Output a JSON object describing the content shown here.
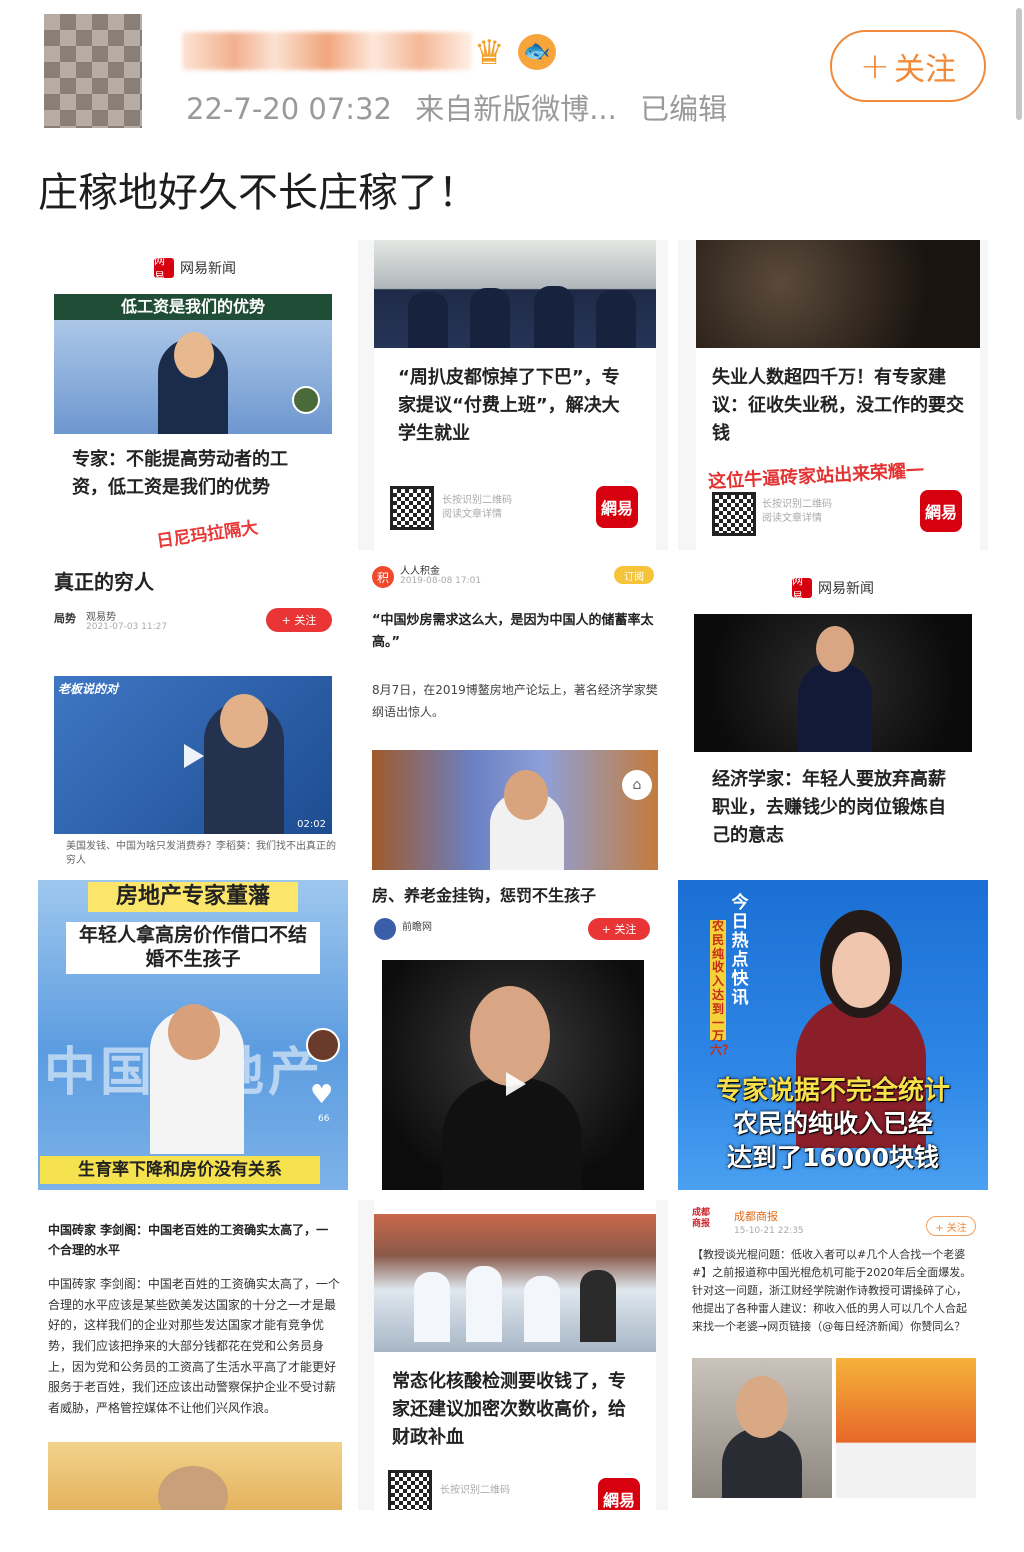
{
  "header": {
    "timestamp": "22-7-20 07:32",
    "source": "来自新版微博...",
    "edited": "已编辑",
    "follow_label": "关注",
    "follow_plus": "+"
  },
  "post": {
    "text": "庄稼地好久不长庄稼了！"
  },
  "colors": {
    "accent": "#f08a3a",
    "netease_red": "#d7000f",
    "follow_red": "#e93536"
  },
  "icons": {
    "crown": "crown-icon",
    "fish": "fish-icon",
    "play": "play-icon",
    "qr": "qr-code-icon"
  },
  "cards": {
    "c1": {
      "brand": "网易新闻",
      "brand_logo": "网易",
      "banner": "低工资是我们的优势",
      "headline": "专家：不能提高劳动者的工资，低工资是我们的优势",
      "stamp": "日尼玛拉隔大"
    },
    "c2": {
      "headline": "“周扒皮都惊掉了下巴”，专家提议“付费上班”，解决大学生就业",
      "qr_text_1": "长按识别二维码",
      "qr_text_2": "阅读文章详情",
      "badge": "網易"
    },
    "c3": {
      "headline": "失业人数超四千万！有专家建议：征收失业税，没工作的要交钱",
      "stamp": "这位牛逼砖家站出来荣耀一",
      "qr_text_1": "长按识别二维码",
      "qr_text_2": "阅读文章详情",
      "badge": "網易"
    },
    "c4": {
      "title": "真正的穷人",
      "author": "观易势",
      "date": "2021-07-03 11:27",
      "follow": "+ 关注",
      "video_tag": "老板说的对",
      "duration": "02:02",
      "caption": "美国发钱、中国为啥只发消费券？李稻葵：我们找不出真正的穷人"
    },
    "c5": {
      "author": "人人积金",
      "date": "2019-08-08 17:01",
      "subscribe": "订阅",
      "quote": "“中国炒房需求这么大，是因为中国人的储蓄率太高。”",
      "body": "8月7日，在2019博鳌房地产论坛上，著名经济学家樊纲语出惊人。"
    },
    "c6": {
      "brand": "网易新闻",
      "brand_logo": "网易",
      "headline": "经济学家：年轻人要放弃高薪职业，去赚钱少的岗位锻炼自己的意志"
    },
    "c7": {
      "title": "房地产专家董藩",
      "subtitle": "年轻人拿高房价作借口不结婚不生孩子",
      "bg_text": "中国房地产",
      "bottom": "生育率下降和房价没有关系",
      "like_count": "66"
    },
    "c8": {
      "headline": "房、养老金挂钩，惩罚不生孩子",
      "author": "前瞻网",
      "follow": "+ 关注"
    },
    "c9": {
      "side_label": "今日热点快讯",
      "side_sub": "农民纯收入达到一万六？",
      "line1": "专家说据不完全统计",
      "line2": "农民的纯收入已经",
      "line3": "达到了16000块钱"
    },
    "c10": {
      "title": "中国砖家 李剑阁：中国老百姓的工资确实太高了，一个合理的水平",
      "body": "中国砖家 李剑阁：中国老百姓的工资确实太高了，一个合理的水平应该是某些欧美发达国家的十分之一才是最好的，这样我们的企业对那些发达国家才能有竞争优势，我们应该把挣来的大部分钱都花在党和公务员身上，因为党和公务员的工资高了生活水平高了才能更好服务于老百姓，我们还应该出动警察保护企业不受讨薪者威胁，严格管控媒体不让他们兴风作浪。"
    },
    "c11": {
      "headline": "常态化核酸检测要收钱了，专家还建议加密次数收高价，给财政补血",
      "qr_text": "长按识别二维码",
      "badge": "網易"
    },
    "c12": {
      "author": "成都商报",
      "date": "15-10-21 22:35",
      "follow": "+ 关注",
      "body": "【教授谈光棍问题：低收入者可以#几个人合找一个老婆#】之前报道称中国光棍危机可能于2020年后全面爆发。针对这一问题，浙江财经学院谢作诗教授可谓操碎了心，他提出了各种雷人建议：称收入低的男人可以几个人合起来找一个老婆→网页链接（@每日经济新闻）你赞同么？"
    }
  }
}
